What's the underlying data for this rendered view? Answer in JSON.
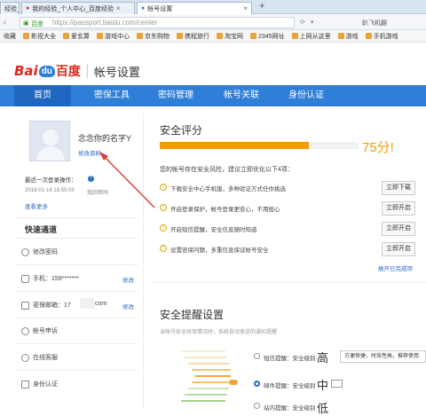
{
  "browser": {
    "tabs": [
      {
        "label": "经验_"
      },
      {
        "label": "我的经验_个人中心_百度经验"
      },
      {
        "label": "帐号设置"
      }
    ],
    "new_tab": "+",
    "url_secure": "百度",
    "url": "https://passport.baidu.com/center",
    "url_right": "趴飞机翻",
    "bookmarks": [
      "收藏",
      "影视大全",
      "爱玄算",
      "游戏中心",
      "京东购物",
      "携程旅行",
      "淘宝网",
      "2345网址",
      "上网从这里",
      "游戏",
      "手机游戏"
    ]
  },
  "brand": {
    "logo_bai": "Bai",
    "logo_du": "du",
    "logo_cn": "百度",
    "page_title": "帐号设置"
  },
  "nav": [
    "首页",
    "密保工具",
    "密码管理",
    "帐号关联",
    "身份认证"
  ],
  "profile": {
    "name": "念念你的名字Y",
    "edit": "修改资料",
    "last_login_label": "最近一次登录操作：",
    "last_login_time": "2018-01-14 18:55:05",
    "last_login_action": "找回密码",
    "more": "查看更多"
  },
  "quick": {
    "title": "快速通道",
    "items": [
      {
        "label": "修改密码",
        "value": "",
        "action": ""
      },
      {
        "label": "手机：159*******",
        "value": "",
        "action": "修改"
      },
      {
        "label": "密保邮箱：17",
        "value": "com",
        "action": "修改"
      },
      {
        "label": "帐号申诉",
        "value": "",
        "action": ""
      },
      {
        "label": "在线客服",
        "value": "",
        "action": ""
      },
      {
        "label": "身份认证",
        "value": "",
        "action": ""
      }
    ]
  },
  "score": {
    "title": "安全评分",
    "value": "75分!",
    "percent": 75,
    "hint": "您的帐号存在安全风险，建议立即优化以下4项：",
    "items": [
      {
        "text": "下载安全中心手机版，多种验证方式任你挑选",
        "button": "立即下载"
      },
      {
        "text": "开启登录保护，帐号登录更安心，不用担心",
        "button": "立即开启"
      },
      {
        "text": "开启短信提醒，安全信息随时知道",
        "button": "立即开启"
      },
      {
        "text": "设置密保问题，多重信息保证帐号安全",
        "button": "立即开启"
      }
    ],
    "expand": "展开已完成项"
  },
  "reminder": {
    "title": "安全提醒设置",
    "desc": "当帐号安全异常情况时，系统自动发送的通知提醒",
    "sms": {
      "label": "短信提醒：安全级别",
      "level": "高",
      "option": "方便快捷，时效性高，推荐使用"
    },
    "mail": {
      "label": "邮件提醒：安全级别",
      "level": "中"
    },
    "third": {
      "label": "站内提醒：安全级别",
      "level": "低"
    }
  },
  "colors": {
    "nav_blue": "#2f7fd8",
    "score_orange": "#f39b00",
    "link_blue": "#2b6cc4"
  }
}
